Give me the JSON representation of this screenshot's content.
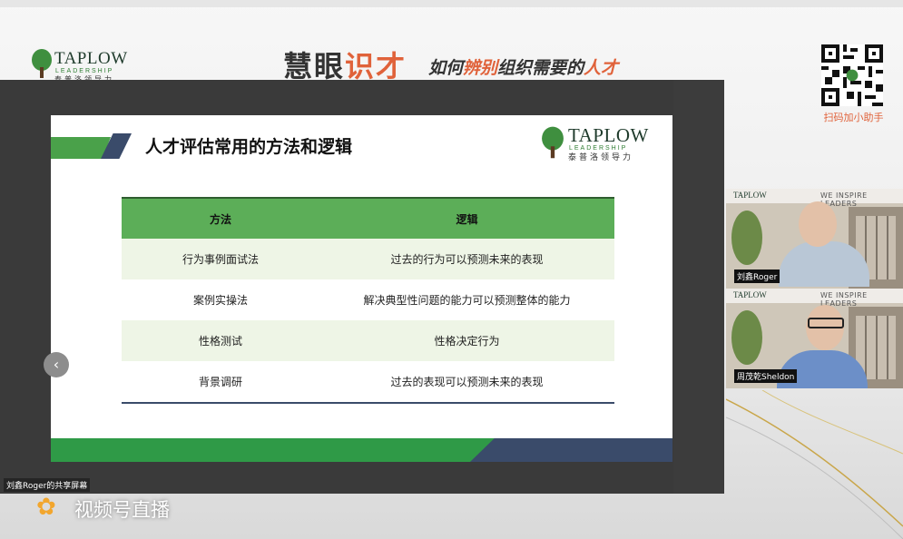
{
  "brand": {
    "name": "TAPLOW",
    "sub": "LEADERSHIP",
    "cn": "泰普洛领导力"
  },
  "event": {
    "title_part1": "慧眼",
    "title_part2": "识才",
    "subtitle_part1": "如何",
    "subtitle_part2": "辨别",
    "subtitle_part3": "组织需要的",
    "subtitle_part4": "人才"
  },
  "qr": {
    "label": "扫码加小助手"
  },
  "slide": {
    "title": "人才评估常用的方法和逻辑",
    "headers": [
      "方法",
      "逻辑"
    ],
    "rows": [
      [
        "行为事例面试法",
        "过去的行为可以预测未来的表现"
      ],
      [
        "案例实操法",
        "解决典型性问题的能力可以预测整体的能力"
      ],
      [
        "性格测试",
        "性格决定行为"
      ],
      [
        "背景调研",
        "过去的表现可以预测未来的表现"
      ]
    ]
  },
  "share": {
    "label": "刘鑫Roger的共享屏幕",
    "prev_icon": "chevron-left-icon"
  },
  "participants": [
    {
      "name": "刘鑫Roger",
      "motto": "WE INSPIRE LEADERS",
      "logo": "TAPLOW"
    },
    {
      "name": "周茂乾Sheldon",
      "motto": "WE INSPIRE LEADERS",
      "logo": "TAPLOW"
    }
  ],
  "live": {
    "icon": "channels-butterfly-icon",
    "label": "视频号直播"
  },
  "colors": {
    "accent_orange": "#e0623a",
    "brand_green": "#4aa14a",
    "navy": "#3a4b6a"
  }
}
